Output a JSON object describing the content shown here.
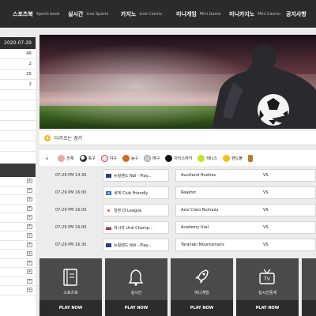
{
  "nav": [
    {
      "ko": "스포츠북",
      "en": "Sports book"
    },
    {
      "ko": "실시간",
      "en": "Live Sports"
    },
    {
      "ko": "카지노",
      "en": "Live Casino"
    },
    {
      "ko": "미니게임",
      "en": "Mini Game"
    },
    {
      "ko": "미니카지노",
      "en": "Mini Casino"
    },
    {
      "ko": "공지사항",
      "en": ""
    }
  ],
  "sidebar": {
    "date": "2020-07-29",
    "counts": [
      "46",
      "2",
      "25",
      "2",
      "",
      "",
      "",
      "",
      "",
      ""
    ],
    "menu": [
      "",
      "",
      "",
      "",
      "",
      "",
      "",
      "",
      "",
      "",
      "",
      "",
      ""
    ],
    "menu_partial": [
      "",
      "",
      "",
      "",
      "",
      "",
      "",
      "",
      "",
      "",
      "",
      "",
      ""
    ]
  },
  "upcoming": {
    "title": "다가오는 경기"
  },
  "tabs": [
    {
      "label": "전체",
      "color": "#e9a8a8"
    },
    {
      "label": "축구",
      "color": "#333333"
    },
    {
      "label": "야구",
      "color": "#dddddd"
    },
    {
      "label": "농구",
      "color": "#d2691e"
    },
    {
      "label": "배구",
      "color": "#cfcfcf"
    },
    {
      "label": "아이스하키",
      "color": "#111111"
    },
    {
      "label": "테니스",
      "color": "#c6e02a"
    },
    {
      "label": "핸드볼",
      "color": "#f2c417"
    }
  ],
  "matches": [
    {
      "date": "07-29 PM 14:30",
      "home": "뉴질랜드 Nbl - Play...",
      "away": "Auckland Huskies",
      "vs": "VS",
      "flag": "blue"
    },
    {
      "date": "07-29 PM 16:00",
      "home": "세계 Club Friendly",
      "away": "Reaktor",
      "vs": "VS",
      "flag": "blue"
    },
    {
      "date": "07-29 PM 16:00",
      "home": "일본 J3 League",
      "away": "Azul Claro Numazu",
      "vs": "VS",
      "flag": "white"
    },
    {
      "date": "07-29 PM 16:00",
      "home": "러시아 Ural Champ...",
      "away": "Academy Ural",
      "vs": "VS",
      "flag": "russia"
    },
    {
      "date": "07-29 PM 16:30",
      "home": "뉴질랜드 Nbl - Play...",
      "away": "Taranaki Mountainairs",
      "vs": "VS",
      "flag": "blue"
    }
  ],
  "tiles": [
    {
      "label": "스포츠북",
      "play": "PLAY NOW",
      "icon": "book-icon"
    },
    {
      "label": "실시간",
      "play": "PLAY NOW",
      "icon": "bell-icon"
    },
    {
      "label": "미니게임",
      "play": "PLAY NOW",
      "icon": "rocket-icon"
    },
    {
      "label": "실시간중계",
      "play": "PLAY NOW",
      "icon": "tv-icon"
    }
  ]
}
